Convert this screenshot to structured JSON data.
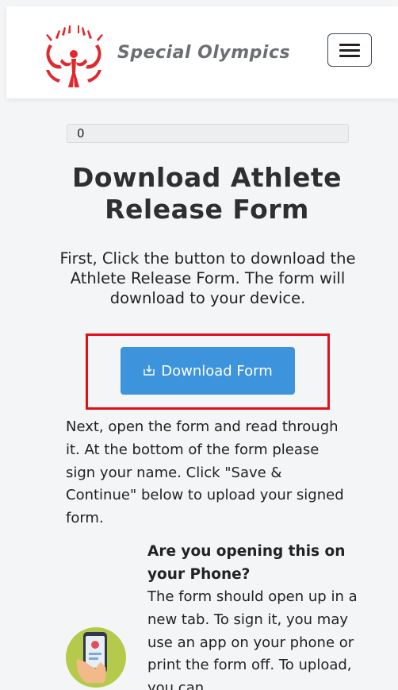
{
  "header": {
    "brand": "Special Olympics",
    "logo_icon": "special-olympics-logo",
    "menu_icon": "hamburger-menu-icon",
    "brand_color": "#e0282e"
  },
  "counter": {
    "value": "0"
  },
  "main": {
    "title": "Download Athlete Release Form",
    "intro": "First, Click the button to download the Athlete Release Form. The form will download to your device.",
    "download_button": {
      "label": "Download Form",
      "icon": "download-icon",
      "color": "#3d94dc"
    },
    "highlight_color": "#e0101a",
    "next_instructions": "Next, open the form and read through it. At the bottom of the form please sign your name. Click \"Save & Continue\" below to upload your signed form."
  },
  "phone_section": {
    "icon": "phone-in-hand-icon",
    "heading": "Are you opening this on your Phone?",
    "text": "The form should open up in a new tab. To sign it, you may use an app on your phone or print the form off. To upload, you can"
  }
}
